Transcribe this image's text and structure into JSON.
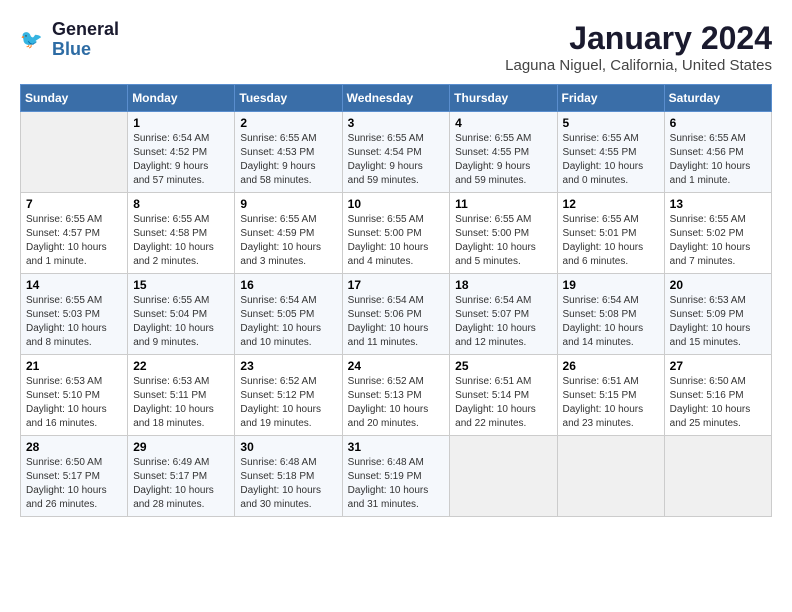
{
  "header": {
    "logo_line1": "General",
    "logo_line2": "Blue",
    "month_year": "January 2024",
    "location": "Laguna Niguel, California, United States"
  },
  "days_of_week": [
    "Sunday",
    "Monday",
    "Tuesday",
    "Wednesday",
    "Thursday",
    "Friday",
    "Saturday"
  ],
  "weeks": [
    [
      {
        "day": "",
        "info": ""
      },
      {
        "day": "1",
        "info": "Sunrise: 6:54 AM\nSunset: 4:52 PM\nDaylight: 9 hours\nand 57 minutes."
      },
      {
        "day": "2",
        "info": "Sunrise: 6:55 AM\nSunset: 4:53 PM\nDaylight: 9 hours\nand 58 minutes."
      },
      {
        "day": "3",
        "info": "Sunrise: 6:55 AM\nSunset: 4:54 PM\nDaylight: 9 hours\nand 59 minutes."
      },
      {
        "day": "4",
        "info": "Sunrise: 6:55 AM\nSunset: 4:55 PM\nDaylight: 9 hours\nand 59 minutes."
      },
      {
        "day": "5",
        "info": "Sunrise: 6:55 AM\nSunset: 4:55 PM\nDaylight: 10 hours\nand 0 minutes."
      },
      {
        "day": "6",
        "info": "Sunrise: 6:55 AM\nSunset: 4:56 PM\nDaylight: 10 hours\nand 1 minute."
      }
    ],
    [
      {
        "day": "7",
        "info": "Sunrise: 6:55 AM\nSunset: 4:57 PM\nDaylight: 10 hours\nand 1 minute."
      },
      {
        "day": "8",
        "info": "Sunrise: 6:55 AM\nSunset: 4:58 PM\nDaylight: 10 hours\nand 2 minutes."
      },
      {
        "day": "9",
        "info": "Sunrise: 6:55 AM\nSunset: 4:59 PM\nDaylight: 10 hours\nand 3 minutes."
      },
      {
        "day": "10",
        "info": "Sunrise: 6:55 AM\nSunset: 5:00 PM\nDaylight: 10 hours\nand 4 minutes."
      },
      {
        "day": "11",
        "info": "Sunrise: 6:55 AM\nSunset: 5:00 PM\nDaylight: 10 hours\nand 5 minutes."
      },
      {
        "day": "12",
        "info": "Sunrise: 6:55 AM\nSunset: 5:01 PM\nDaylight: 10 hours\nand 6 minutes."
      },
      {
        "day": "13",
        "info": "Sunrise: 6:55 AM\nSunset: 5:02 PM\nDaylight: 10 hours\nand 7 minutes."
      }
    ],
    [
      {
        "day": "14",
        "info": "Sunrise: 6:55 AM\nSunset: 5:03 PM\nDaylight: 10 hours\nand 8 minutes."
      },
      {
        "day": "15",
        "info": "Sunrise: 6:55 AM\nSunset: 5:04 PM\nDaylight: 10 hours\nand 9 minutes."
      },
      {
        "day": "16",
        "info": "Sunrise: 6:54 AM\nSunset: 5:05 PM\nDaylight: 10 hours\nand 10 minutes."
      },
      {
        "day": "17",
        "info": "Sunrise: 6:54 AM\nSunset: 5:06 PM\nDaylight: 10 hours\nand 11 minutes."
      },
      {
        "day": "18",
        "info": "Sunrise: 6:54 AM\nSunset: 5:07 PM\nDaylight: 10 hours\nand 12 minutes."
      },
      {
        "day": "19",
        "info": "Sunrise: 6:54 AM\nSunset: 5:08 PM\nDaylight: 10 hours\nand 14 minutes."
      },
      {
        "day": "20",
        "info": "Sunrise: 6:53 AM\nSunset: 5:09 PM\nDaylight: 10 hours\nand 15 minutes."
      }
    ],
    [
      {
        "day": "21",
        "info": "Sunrise: 6:53 AM\nSunset: 5:10 PM\nDaylight: 10 hours\nand 16 minutes."
      },
      {
        "day": "22",
        "info": "Sunrise: 6:53 AM\nSunset: 5:11 PM\nDaylight: 10 hours\nand 18 minutes."
      },
      {
        "day": "23",
        "info": "Sunrise: 6:52 AM\nSunset: 5:12 PM\nDaylight: 10 hours\nand 19 minutes."
      },
      {
        "day": "24",
        "info": "Sunrise: 6:52 AM\nSunset: 5:13 PM\nDaylight: 10 hours\nand 20 minutes."
      },
      {
        "day": "25",
        "info": "Sunrise: 6:51 AM\nSunset: 5:14 PM\nDaylight: 10 hours\nand 22 minutes."
      },
      {
        "day": "26",
        "info": "Sunrise: 6:51 AM\nSunset: 5:15 PM\nDaylight: 10 hours\nand 23 minutes."
      },
      {
        "day": "27",
        "info": "Sunrise: 6:50 AM\nSunset: 5:16 PM\nDaylight: 10 hours\nand 25 minutes."
      }
    ],
    [
      {
        "day": "28",
        "info": "Sunrise: 6:50 AM\nSunset: 5:17 PM\nDaylight: 10 hours\nand 26 minutes."
      },
      {
        "day": "29",
        "info": "Sunrise: 6:49 AM\nSunset: 5:17 PM\nDaylight: 10 hours\nand 28 minutes."
      },
      {
        "day": "30",
        "info": "Sunrise: 6:48 AM\nSunset: 5:18 PM\nDaylight: 10 hours\nand 30 minutes."
      },
      {
        "day": "31",
        "info": "Sunrise: 6:48 AM\nSunset: 5:19 PM\nDaylight: 10 hours\nand 31 minutes."
      },
      {
        "day": "",
        "info": ""
      },
      {
        "day": "",
        "info": ""
      },
      {
        "day": "",
        "info": ""
      }
    ]
  ]
}
